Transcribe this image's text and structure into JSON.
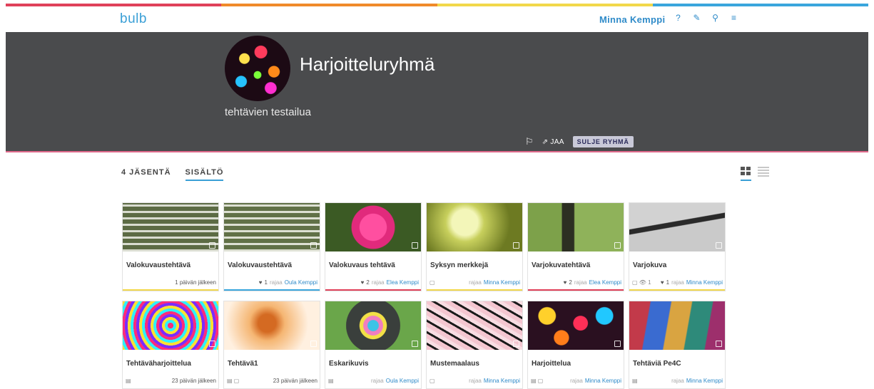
{
  "brand": {
    "logo": "bulb"
  },
  "colors": {
    "accent": "#2f8bc9",
    "header_bg": "#4a4b4d",
    "stripe": [
      "#e0415a",
      "#f08a2a",
      "#f2d84a",
      "#3aa6dd"
    ]
  },
  "topbar": {
    "user_name": "Minna Kemppi",
    "icons": [
      "help-icon",
      "edit-icon",
      "search-icon",
      "menu-icon"
    ]
  },
  "group": {
    "title": "Harjoitteluryhmä",
    "description": "tehtävien testailua",
    "share_label": "JAA",
    "close_label": "SULJE RYHMÄ"
  },
  "tabs": [
    {
      "label": "4 JÄSENTÄ",
      "active": false
    },
    {
      "label": "SISÄLTÖ",
      "active": true
    }
  ],
  "cards": [
    {
      "title": "Valokuvaustehtävä",
      "thumb": "fence",
      "left": "",
      "likes": "",
      "by": "",
      "author": "",
      "deadline": "1 päivän jälkeen",
      "bar": "#f2d84a"
    },
    {
      "title": "Valokuvaustehtävä",
      "thumb": "fence2",
      "left": "",
      "likes": "1",
      "by": "rajaa",
      "author": "Oula Kemppi",
      "deadline": "",
      "bar": "#3aa6dd"
    },
    {
      "title": "Valokuvaus tehtävä",
      "thumb": "flower",
      "left": "",
      "likes": "2",
      "by": "rajaa",
      "author": "Elea Kemppi",
      "deadline": "",
      "bar": "#e0415a"
    },
    {
      "title": "Syksyn merkkejä",
      "thumb": "leaves",
      "left": "▢",
      "likes": "",
      "by": "rajaa",
      "author": "Minna Kemppi",
      "deadline": "",
      "bar": "#f2d84a"
    },
    {
      "title": "Varjokuvatehtävä",
      "thumb": "shadow",
      "left": "",
      "likes": "2",
      "by": "rajaa",
      "author": "Elea Kemppi",
      "deadline": "",
      "bar": "#e0415a"
    },
    {
      "title": "Varjokuva",
      "thumb": "varjo",
      "left": "▢ 👁 1",
      "likes": "1",
      "by": "rajaa",
      "author": "Minna Kemppi",
      "deadline": "",
      "bar": "#f2d84a"
    },
    {
      "title": "Tehtäväharjoittelua",
      "thumb": "spiral",
      "left": "▤",
      "likes": "",
      "by": "",
      "author": "",
      "deadline": "23 päivän jälkeen",
      "bar": ""
    },
    {
      "title": "Tehtävä1",
      "thumb": "autumn",
      "left": "▤ ▢",
      "likes": "",
      "by": "",
      "author": "",
      "deadline": "23 päivän jälkeen",
      "bar": ""
    },
    {
      "title": "Eskarikuvis",
      "thumb": "chalk",
      "left": "▤",
      "likes": "",
      "by": "rajaa",
      "author": "Oula Kemppi",
      "deadline": "",
      "bar": ""
    },
    {
      "title": "Mustemaalaus",
      "thumb": "ink",
      "left": "▢",
      "likes": "",
      "by": "rajaa",
      "author": "Minna Kemppi",
      "deadline": "",
      "bar": ""
    },
    {
      "title": "Harjoittelua",
      "thumb": "bokeh",
      "left": "▤ ▢",
      "likes": "",
      "by": "rajaa",
      "author": "Minna Kemppi",
      "deadline": "",
      "bar": ""
    },
    {
      "title": "Tehtäviä Pe4C",
      "thumb": "brush",
      "left": "▤",
      "likes": "",
      "by": "rajaa",
      "author": "Minna Kemppi",
      "deadline": "",
      "bar": ""
    }
  ]
}
